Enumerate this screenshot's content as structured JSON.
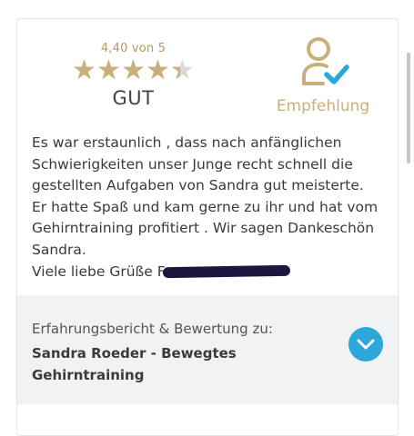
{
  "rating": {
    "score_text": "4,40 von 5",
    "score": 4.4,
    "max": 5,
    "word": "GUT"
  },
  "recommendation": {
    "label": "Empfehlung",
    "icon": "user-check-icon"
  },
  "review": {
    "lines": [
      "Es war erstaunlich , dass nach anfänglichen",
      "Schwierigkeiten unser Junge recht schnell die",
      "gestellten Aufgaben von Sandra gut meisterte.",
      "Er hatte Spaß und kam gerne zu ihr und hat vom",
      "Gehirntraining profitiert . Wir sagen Dankeschön",
      "Sandra."
    ],
    "greeting": "Viele liebe Grüße F"
  },
  "footer": {
    "label": "Erfahrungsbericht & Bewertung zu:",
    "title": "Sandra Roeder - Bewegtes Gehirntraining"
  },
  "colors": {
    "gold": "#c9b07a",
    "accent": "#2ba7da",
    "footer_bg": "#f1f2f3"
  }
}
